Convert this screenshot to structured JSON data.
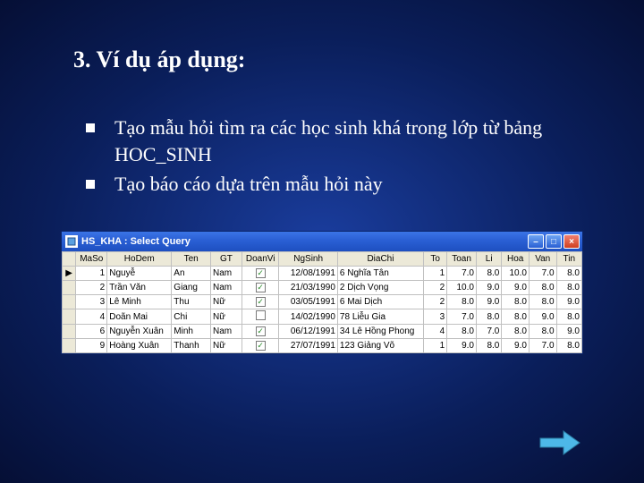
{
  "slide": {
    "title": "3. Ví dụ áp dụng:",
    "bullets": [
      "Tạo mẫu hỏi tìm ra các học sinh khá trong lớp từ bảng HOC_SINH",
      "Tạo báo cáo dựa trên mẫu hỏi này"
    ]
  },
  "window": {
    "title": "HS_KHA : Select Query",
    "columns": [
      "MaSo",
      "HoDem",
      "Ten",
      "GT",
      "DoanVi",
      "NgSinh",
      "DiaChi",
      "To",
      "Toan",
      "Li",
      "Hoa",
      "Van",
      "Tin"
    ],
    "rows": [
      {
        "sel": "▶",
        "MaSo": "1",
        "HoDem": "Nguyễ",
        "Ten": "An",
        "GT": "Nam",
        "DoanVi": true,
        "NgSinh": "12/08/1991",
        "DiaChi": "6 Nghĩa Tân",
        "To": "1",
        "Toan": "7.0",
        "Li": "8.0",
        "Hoa": "10.0",
        "Van": "7.0",
        "Tin": "8.0"
      },
      {
        "sel": "",
        "MaSo": "2",
        "HoDem": "Trần Văn",
        "Ten": "Giang",
        "GT": "Nam",
        "DoanVi": true,
        "NgSinh": "21/03/1990",
        "DiaChi": "2 Dịch Vọng",
        "To": "2",
        "Toan": "10.0",
        "Li": "9.0",
        "Hoa": "9.0",
        "Van": "8.0",
        "Tin": "8.0"
      },
      {
        "sel": "",
        "MaSo": "3",
        "HoDem": "Lê Minh",
        "Ten": "Thu",
        "GT": "Nữ",
        "DoanVi": true,
        "NgSinh": "03/05/1991",
        "DiaChi": "6 Mai Dịch",
        "To": "2",
        "Toan": "8.0",
        "Li": "9.0",
        "Hoa": "8.0",
        "Van": "8.0",
        "Tin": "9.0"
      },
      {
        "sel": "",
        "MaSo": "4",
        "HoDem": "Doãn Mai",
        "Ten": "Chi",
        "GT": "Nữ",
        "DoanVi": false,
        "NgSinh": "14/02/1990",
        "DiaChi": "78 Liễu Gia",
        "To": "3",
        "Toan": "7.0",
        "Li": "8.0",
        "Hoa": "8.0",
        "Van": "9.0",
        "Tin": "8.0"
      },
      {
        "sel": "",
        "MaSo": "6",
        "HoDem": "Nguyễn Xuân",
        "Ten": "Minh",
        "GT": "Nam",
        "DoanVi": true,
        "NgSinh": "06/12/1991",
        "DiaChi": "34 Lê Hồng Phong",
        "To": "4",
        "Toan": "8.0",
        "Li": "7.0",
        "Hoa": "8.0",
        "Van": "8.0",
        "Tin": "9.0"
      },
      {
        "sel": "",
        "MaSo": "9",
        "HoDem": "Hoàng Xuân",
        "Ten": "Thanh",
        "GT": "Nữ",
        "DoanVi": true,
        "NgSinh": "27/07/1991",
        "DiaChi": "123 Giảng Võ",
        "To": "1",
        "Toan": "9.0",
        "Li": "8.0",
        "Hoa": "9.0",
        "Van": "7.0",
        "Tin": "8.0"
      }
    ]
  }
}
